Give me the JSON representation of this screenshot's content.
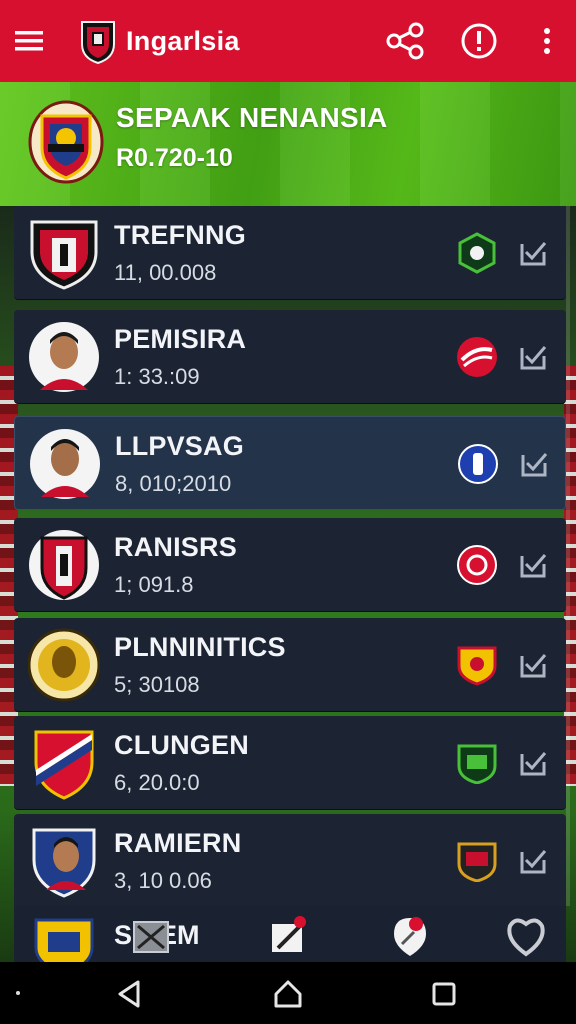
{
  "appbar": {
    "title": "Ingarlsia",
    "icons": [
      "menu-icon",
      "club-logo",
      "share-icon",
      "alert-icon",
      "more-vert-icon"
    ],
    "color": "#d8102f"
  },
  "hero": {
    "title": "SEPAΛK NENANSIA",
    "subtitle": "R0.720-10"
  },
  "rows": [
    {
      "name": "TREFNNG",
      "meta": "11, 00.008",
      "avatar": "club-crest-red-black",
      "badge": "green-shield-badge",
      "selected": false
    },
    {
      "name": "PEMISIRA",
      "meta": "1: 33.:09",
      "avatar": "player-photo",
      "badge": "red-swoosh-badge",
      "selected": false
    },
    {
      "name": "LLPVSAG",
      "meta": "8, 010;2010",
      "avatar": "player-photo",
      "badge": "blue-circle-badge",
      "selected": true
    },
    {
      "name": "RANISRS",
      "meta": "1; 091.8",
      "avatar": "club-crest-red-white",
      "badge": "red-circle-badge",
      "selected": false
    },
    {
      "name": "PLNNINITICS",
      "meta": "5; 30108",
      "avatar": "club-crest-gold",
      "badge": "yellow-shield-badge",
      "selected": false
    },
    {
      "name": "CLUNGEN",
      "meta": "6, 20.0:0",
      "avatar": "club-crest-red-blue",
      "badge": "green-shield-badge-2",
      "selected": false
    },
    {
      "name": "RAMIERN",
      "meta": "3, 10 0.06",
      "avatar": "player-photo-shield",
      "badge": "dark-shield-badge",
      "selected": false
    }
  ],
  "peek_row": {
    "name": "SKIEM"
  },
  "tabs": [
    "close-box-icon",
    "edit-icon",
    "pin-icon",
    "heart-icon"
  ],
  "nav": [
    "back-icon",
    "home-icon",
    "recents-icon"
  ]
}
